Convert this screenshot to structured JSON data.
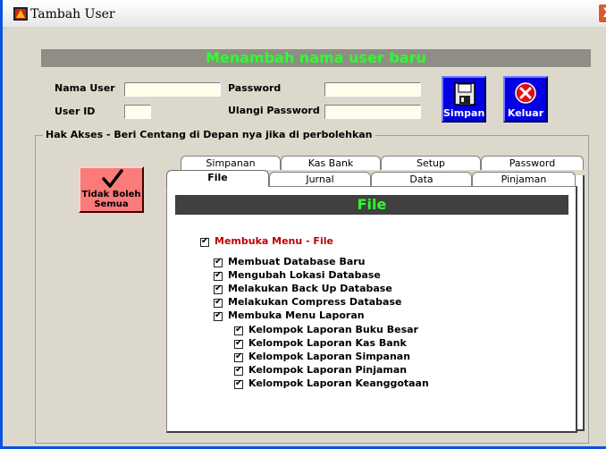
{
  "window": {
    "title": "Tambah User",
    "close_glyph": "X"
  },
  "banner": {
    "text": "Menambah nama user baru"
  },
  "form": {
    "nama_user_label": "Nama User",
    "user_id_label": "User ID",
    "password_label": "Password",
    "ulangi_password_label": "Ulangi Password",
    "nama_user_value": "",
    "user_id_value": "",
    "password_value": "",
    "ulangi_password_value": ""
  },
  "buttons": {
    "simpan": "Simpan",
    "keluar": "Keluar",
    "deny_all": "Tidak Boleh Semua"
  },
  "group": {
    "title": "Hak Akses - Beri Centang di Depan nya jika di perbolehkan"
  },
  "tabs": {
    "row_back": [
      "Simpanan",
      "Kas Bank",
      "Setup",
      "Password"
    ],
    "row_front": [
      "File",
      "Jurnal",
      "Data",
      "Pinjaman"
    ],
    "active": "File"
  },
  "panel": {
    "header": "File",
    "main_item": "Membuka Menu - File",
    "items": [
      "Membuat Database Baru",
      "Mengubah Lokasi Database",
      "Melakukan Back Up Database",
      "Melakukan Compress Database",
      "Membuka Menu Laporan"
    ],
    "sub_items": [
      "Kelompok Laporan Buku Besar",
      "Kelompok Laporan Kas Bank",
      "Kelompok Laporan Simpanan",
      "Kelompok Laporan Pinjaman",
      "Kelompok Laporan Keanggotaan"
    ]
  },
  "colors": {
    "banner_text": "#2dff2d",
    "main_item_text": "#c00000",
    "button_blue": "#0000e0",
    "deny_red": "#fb7a7a"
  },
  "icons": {
    "save": "floppy-disk-icon",
    "exit": "red-x-circle-icon",
    "deny": "check-mark-icon",
    "app": "app-icon"
  }
}
